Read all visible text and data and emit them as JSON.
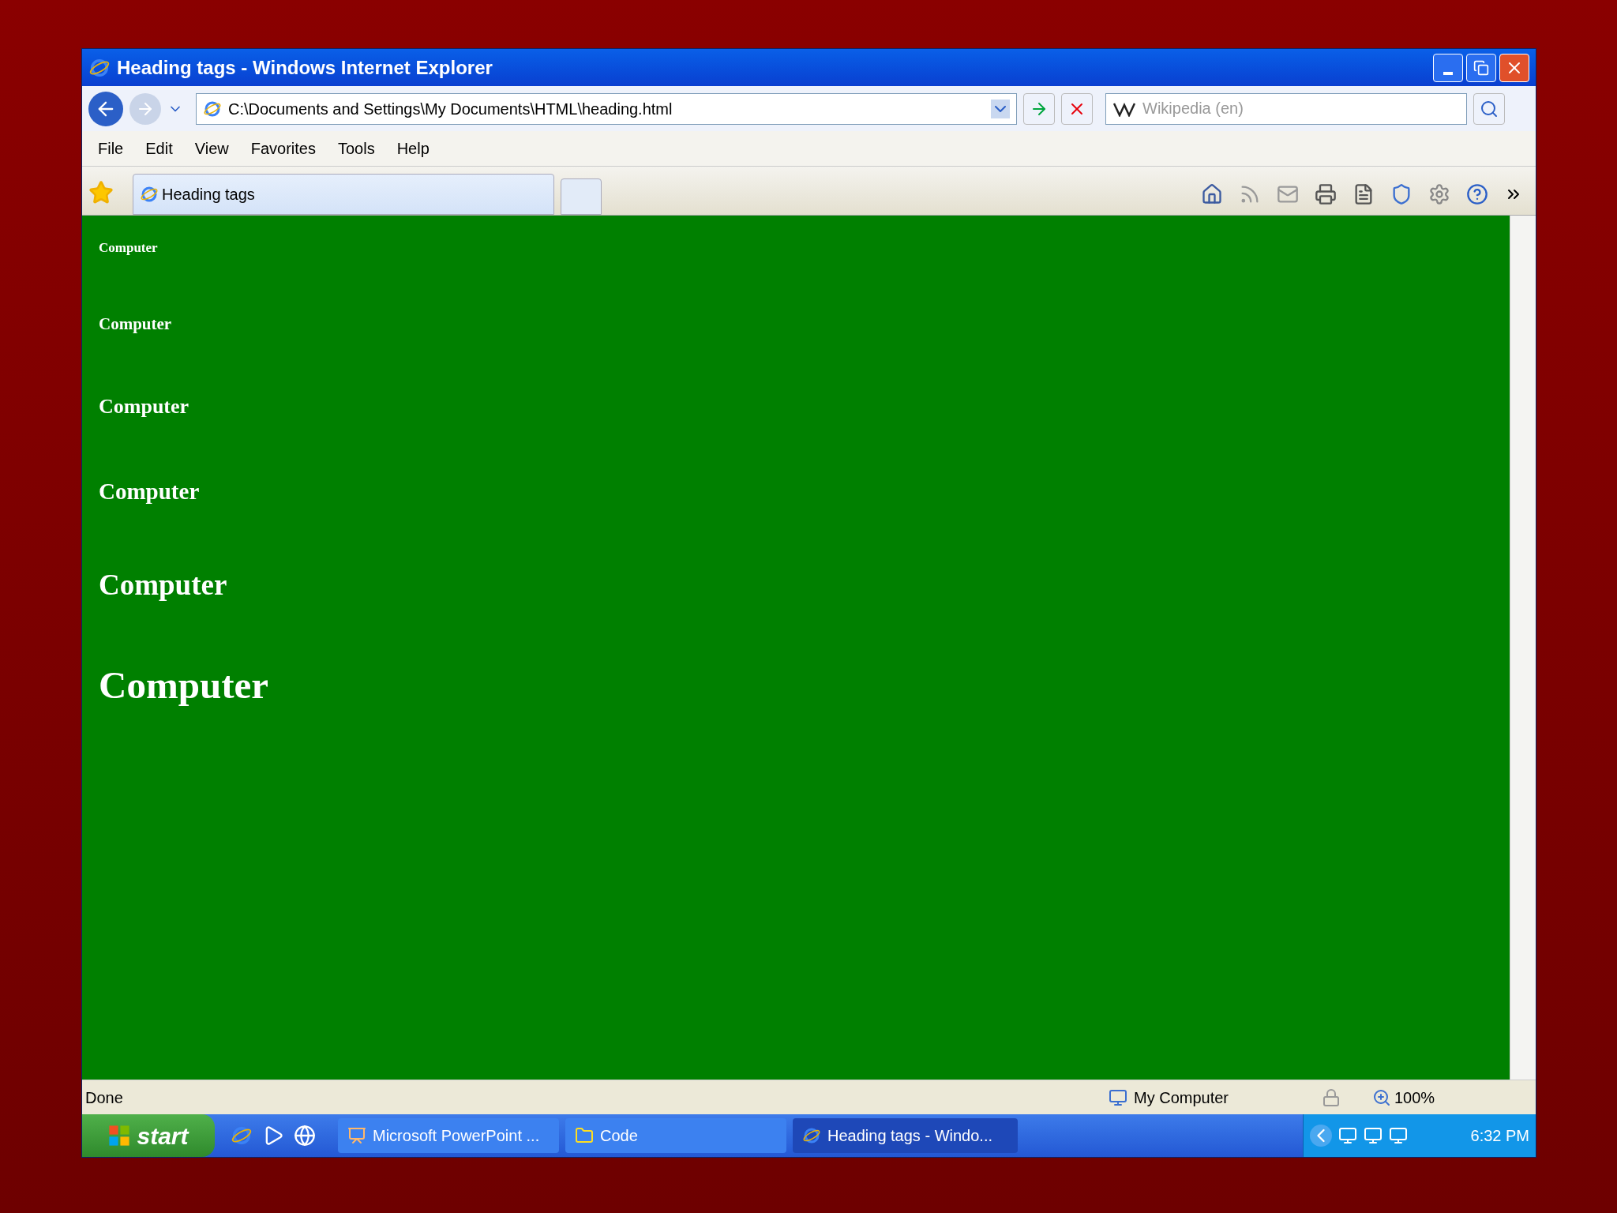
{
  "window": {
    "title": "Heading tags - Windows Internet Explorer"
  },
  "address": {
    "url": "C:\\Documents and Settings\\My Documents\\HTML\\heading.html"
  },
  "search": {
    "placeholder": "Wikipedia (en)"
  },
  "menu": [
    "File",
    "Edit",
    "View",
    "Favorites",
    "Tools",
    "Help"
  ],
  "tabs": [
    {
      "label": "Heading tags",
      "selected": true
    }
  ],
  "headings": [
    {
      "kind": "h6",
      "text": "Computer"
    },
    {
      "kind": "h5",
      "text": "Computer"
    },
    {
      "kind": "h4",
      "text": "Computer"
    },
    {
      "kind": "h3",
      "text": "Computer"
    },
    {
      "kind": "h2",
      "text": "Computer"
    },
    {
      "kind": "h1",
      "text": "Computer"
    }
  ],
  "status_bar": {
    "status": "Done",
    "zone": "My Computer",
    "zoom": "100%"
  },
  "taskbar": {
    "start": "start",
    "tasks": [
      {
        "label": "Microsoft PowerPoint ...",
        "kind": "slides",
        "selected": false
      },
      {
        "label": "Code",
        "kind": "folder",
        "selected": false
      },
      {
        "label": "Heading tags - Windo...",
        "kind": "browser",
        "selected": true
      }
    ],
    "clock": "6:32 PM"
  }
}
